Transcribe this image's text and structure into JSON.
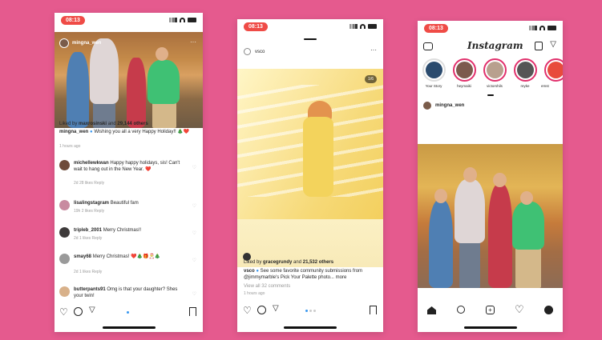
{
  "phone1": {
    "time": "08:13",
    "username": "mingna_wen",
    "liked_by": "Liked by",
    "liked_user": "maxrosinski",
    "liked_and": "and",
    "liked_count": "29,144 others",
    "caption_user": "mingna_wen",
    "caption_text": "Wishing you all a very Happy Holiday!! 🎄❤️",
    "time_ago": "1 hours ago",
    "comments": [
      {
        "user": "michellewkwan",
        "text": "Happy happy holidays, sis! Can't wait to hang out in the New Year. ❤️",
        "meta": "2d   28 likes   Reply"
      },
      {
        "user": "lisalingstagram",
        "text": "Beautiful fam",
        "meta": "19h   2 likes   Reply"
      },
      {
        "user": "tripleb_2001",
        "text": "Merry Christmas!!",
        "meta": "2d   1 likes   Reply"
      },
      {
        "user": "smay68",
        "text": "Merry Christmas! ❤️🎄🎁🎅🎄",
        "meta": "2d   1 likes   Reply"
      },
      {
        "user": "butterpants91",
        "text": "Omg is that your daughter? Shes your twin!",
        "meta": ""
      }
    ]
  },
  "phone2": {
    "time": "08:13",
    "username": "vsco",
    "counter": "1/6",
    "liked_by": "Liked by",
    "liked_user": "gracegrundy",
    "liked_and": "and",
    "liked_count": "21,532 others",
    "caption_user": "vsco",
    "caption_text": "See some favorite community submissions from @jimmymarble's Pick Your Palette photo... more",
    "view_all": "View all 32 comments",
    "time_ago": "1 hours ago"
  },
  "phone3": {
    "time": "08:13",
    "app_title": "Instagram",
    "stories": [
      {
        "label": "Your Story"
      },
      {
        "label": "heymaiki"
      },
      {
        "label": "victorshils"
      },
      {
        "label": "reyke"
      },
      {
        "label": "emst"
      }
    ],
    "username": "mingna_wen"
  },
  "colors": {
    "background": "#e55a8e",
    "time_pill": "#ef4b46",
    "story_ring": "#e1306c",
    "accent_blue": "#3897f0"
  }
}
